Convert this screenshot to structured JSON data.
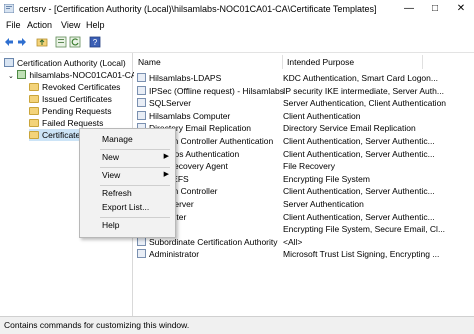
{
  "window": {
    "title": "certsrv - [Certification Authority (Local)\\hilsamlabs-NOC01CA01-CA\\Certificate Templates]"
  },
  "menu": [
    "File",
    "Action",
    "View",
    "Help"
  ],
  "tree": {
    "root": "Certification Authority (Local)",
    "ca": "hilsamlabs-NOC01CA01-CA",
    "folders": [
      "Revoked Certificates",
      "Issued Certificates",
      "Pending Requests",
      "Failed Requests",
      "Certificate Templates"
    ]
  },
  "list": {
    "columns": [
      "Name",
      "Intended Purpose"
    ],
    "rows": [
      {
        "name": "Hilsamlabs-LDAPS",
        "purpose": "KDC Authentication, Smart Card Logon..."
      },
      {
        "name": "IPSec (Offline request) - Hilsamlabs",
        "purpose": "IP security IKE intermediate, Server Auth..."
      },
      {
        "name": "SQLServer",
        "purpose": "Server Authentication, Client Authentication"
      },
      {
        "name": "Hilsamlabs Computer",
        "purpose": "Client Authentication"
      },
      {
        "name": "Directory Email Replication",
        "purpose": "Directory Service Email Replication"
      },
      {
        "name": "Domain Controller Authentication",
        "purpose": "Client Authentication, Server Authentic..."
      },
      {
        "name": "Kerberos Authentication",
        "purpose": "Client Authentication, Server Authentic..."
      },
      {
        "name": "EFS Recovery Agent",
        "purpose": "File Recovery"
      },
      {
        "name": "Basic EFS",
        "purpose": "Encrypting File System"
      },
      {
        "name": "Domain Controller",
        "purpose": "Client Authentication, Server Authentic..."
      },
      {
        "name": "Web Server",
        "purpose": "Server Authentication"
      },
      {
        "name": "Computer",
        "purpose": "Client Authentication, Server Authentic..."
      },
      {
        "name": "User",
        "purpose": "Encrypting File System, Secure Email, Cl..."
      },
      {
        "name": "Subordinate Certification Authority",
        "purpose": "<All>"
      },
      {
        "name": "Administrator",
        "purpose": "Microsoft Trust List Signing, Encrypting ..."
      }
    ]
  },
  "context_menu": [
    "Manage",
    "New",
    "View",
    "Refresh",
    "Export List...",
    "Help"
  ],
  "status": "Contains commands for customizing this window."
}
